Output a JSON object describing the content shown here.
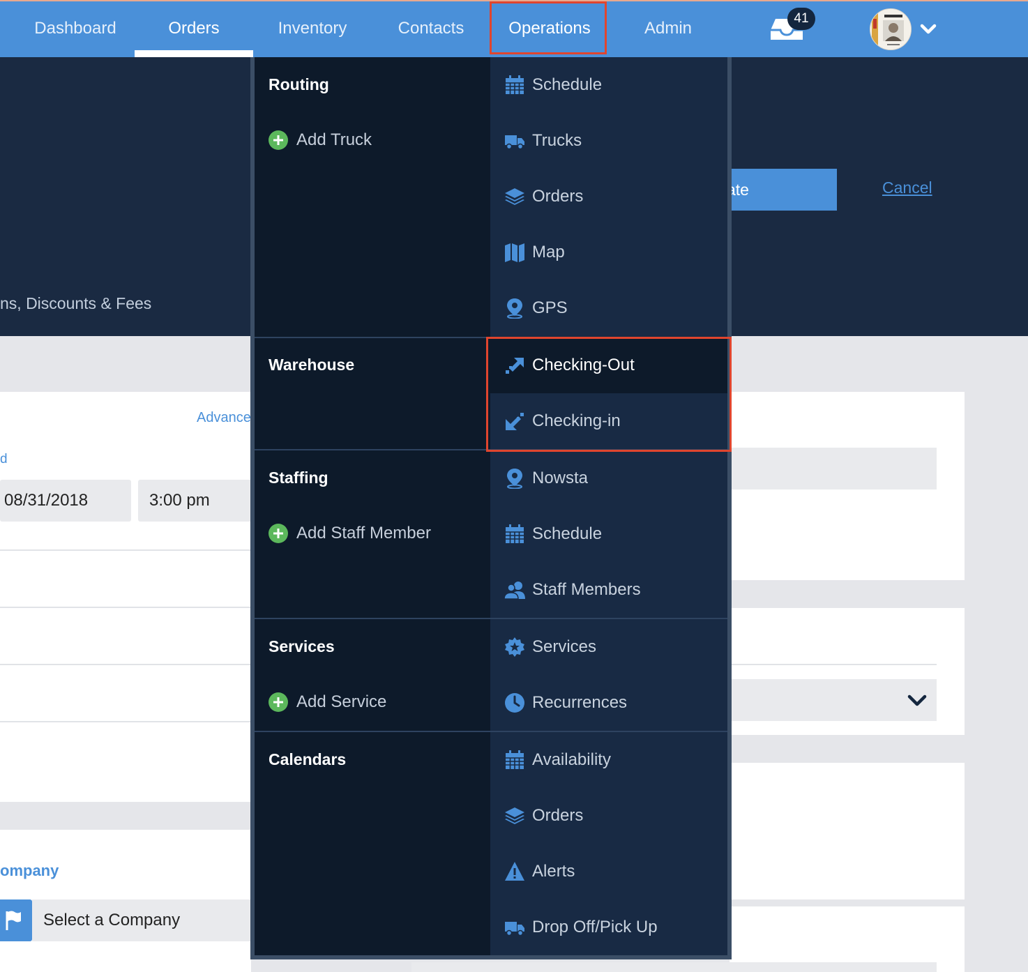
{
  "nav": {
    "items": [
      "Dashboard",
      "Orders",
      "Inventory",
      "Contacts",
      "Operations",
      "Admin"
    ],
    "active": "Orders",
    "notification_count": "41"
  },
  "page": {
    "hero_text": "ns, Discounts & Fees",
    "hero_button": "ate",
    "cancel": "Cancel",
    "advanced_link": "Advance",
    "field_label": "d",
    "date_value": "08/31/2018",
    "time_value": "3:00 pm",
    "company_label": "ompany",
    "company_select": "Select a Company"
  },
  "menu": {
    "groups": [
      {
        "title": "Routing",
        "add": "Add Truck",
        "items": [
          {
            "label": "Schedule",
            "icon": "calendar-icon"
          },
          {
            "label": "Trucks",
            "icon": "truck-icon"
          },
          {
            "label": "Orders",
            "icon": "layers-icon"
          },
          {
            "label": "Map",
            "icon": "map-icon"
          },
          {
            "label": "GPS",
            "icon": "map-pin-icon"
          }
        ]
      },
      {
        "title": "Warehouse",
        "items": [
          {
            "label": "Checking-Out",
            "icon": "arrow-out-icon"
          },
          {
            "label": "Checking-in",
            "icon": "arrow-in-icon"
          }
        ]
      },
      {
        "title": "Staffing",
        "add": "Add Staff Member",
        "items": [
          {
            "label": "Nowsta",
            "icon": "map-pin-icon"
          },
          {
            "label": "Schedule",
            "icon": "calendar-icon"
          },
          {
            "label": "Staff Members",
            "icon": "users-icon"
          }
        ]
      },
      {
        "title": "Services",
        "add": "Add Service",
        "items": [
          {
            "label": "Services",
            "icon": "badge-star-icon"
          },
          {
            "label": "Recurrences",
            "icon": "clock-icon"
          }
        ]
      },
      {
        "title": "Calendars",
        "items": [
          {
            "label": "Availability",
            "icon": "calendar-icon"
          },
          {
            "label": "Orders",
            "icon": "layers-icon"
          },
          {
            "label": "Alerts",
            "icon": "warning-icon"
          },
          {
            "label": "Drop Off/Pick Up",
            "icon": "truck-icon"
          }
        ]
      }
    ]
  },
  "colors": {
    "nav_blue": "#4a90d9",
    "menu_dark": "#0d1a2a",
    "menu_panel": "#182a44",
    "icon_blue": "#4a90d9",
    "add_green": "#5cb85c",
    "highlight_red": "#e0452e"
  }
}
